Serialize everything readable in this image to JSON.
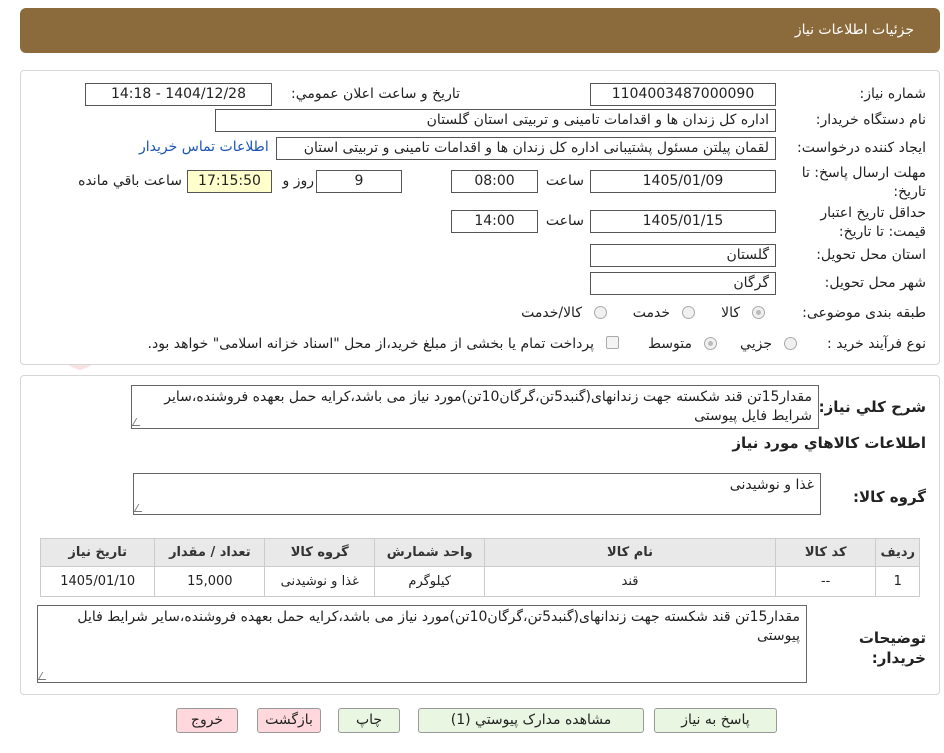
{
  "header": {
    "title": "جزئیات اطلاعات نیاز"
  },
  "form": {
    "need_number_label": "شماره نیاز:",
    "need_number_value": "1104003487000090",
    "announce_label": "تاریخ و ساعت اعلان عمومي:",
    "announce_value": "1404/12/28 - 14:18",
    "buyer_org_label": "نام دستگاه خریدار:",
    "buyer_org_value": "اداره کل زندان ها و اقدامات تامینی و تربیتی استان گلستان",
    "requester_label": "ایجاد کننده درخواست:",
    "requester_value": "لقمان پیلتن مسئول پشتیبانی اداره کل زندان ها و اقدامات تامینی و تربیتی استان",
    "contact_link": "اطلاعات تماس خریدار",
    "deadline_label": "مهلت ارسال پاسخ: تا تاریخ:",
    "deadline_date": "1405/01/09",
    "time_label": "ساعت",
    "deadline_time": "08:00",
    "days_value": "9",
    "days_label": "روز و",
    "remaining_time": "17:15:50",
    "remaining_label": "ساعت باقي مانده",
    "validity_label": "حداقل تاریخ اعتبار قیمت: تا تاریخ:",
    "validity_date": "1405/01/15",
    "validity_time": "14:00",
    "province_label": "استان محل تحویل:",
    "province_value": "گلستان",
    "city_label": "شهر محل تحویل:",
    "city_value": "گرگان",
    "category_label": "طبقه بندی موضوعی:",
    "category_options": [
      "کالا",
      "خدمت",
      "کالا/خدمت"
    ],
    "category_selected": "کالا",
    "process_label": "نوع فرآیند خرید :",
    "process_options": [
      "جزیي",
      "متوسط"
    ],
    "process_selected": "متوسط",
    "payment_note": "پرداخت تمام یا بخشی از مبلغ خرید،از محل \"اسناد خزانه اسلامی\" خواهد بود."
  },
  "description": {
    "label": "شرح کلي نیاز:",
    "text": "مقدار15تن قند شکسته جهت زندانهای(گنبد5تن،گرگان10تن)مورد نیاز می باشد،کرایه حمل بعهده فروشنده،سایر شرایط فایل پیوستی"
  },
  "goods_section": {
    "title": "اطلاعات کالاهاي مورد نیاز",
    "group_label": "گروه کالا:",
    "group_value": "غذا و نوشیدنی"
  },
  "table": {
    "headers": [
      "ردیف",
      "کد کالا",
      "نام کالا",
      "واحد شمارش",
      "گروه کالا",
      "تعداد / مقدار",
      "تاریخ نیاز"
    ],
    "rows": [
      [
        "1",
        "--",
        "قند",
        "کیلوگرم",
        "غذا و نوشیدنی",
        "15,000",
        "1405/01/10"
      ]
    ]
  },
  "buyer_notes": {
    "label": "توضیحات خریدار:",
    "text": "مقدار15تن قند شکسته جهت زندانهای(گنبد5تن،گرگان10تن)مورد نیاز می باشد،کرایه حمل بعهده فروشنده،سایر شرایط فایل پیوستی"
  },
  "buttons": {
    "reply": "پاسخ به نیاز",
    "attachments": "مشاهده مدارک پیوستي (1)",
    "print": "چاپ",
    "back": "بازگشت",
    "exit": "خروج"
  },
  "colors": {
    "header_bg": "#8B6A3C",
    "remaining_bg": "#FFFFCC",
    "green_button": "#E8F6E2",
    "pink_button": "#FFD8DD",
    "link": "#1a55b5"
  }
}
